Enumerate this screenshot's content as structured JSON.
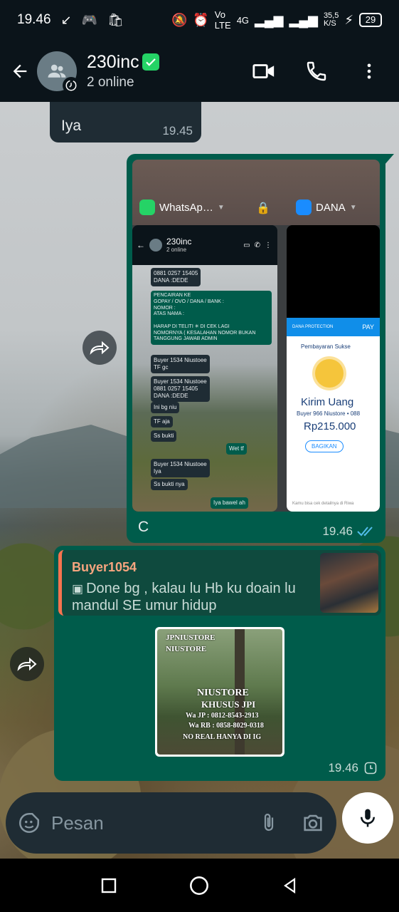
{
  "status_bar": {
    "time": "19.46",
    "net_speed": "35,5\nK/S",
    "battery": "29",
    "network": "4G"
  },
  "header": {
    "title": "230inc",
    "subtitle": "2 online"
  },
  "messages": [
    {
      "text": "Iya",
      "time": "19.45"
    },
    {
      "caption": "C",
      "time": "19.46",
      "screenshot": {
        "app1": "WhatsAp…",
        "app2": "DANA",
        "mini_title": "230inc",
        "mini_sub": "2 online",
        "lines": [
          "0881 0257 15405\nDANA :DEDE",
          "PENCAIRAN KE\nGOPAY / OVO / DANA / BANK :\nNOMOR :\nATAS NAMA :\n\nHARAP DI TELITI ✳ DI CEK LAGI\nNOMORNYA ( KESALAHAN NOMOR BUKAN\nTANGGUNG JAWAB ADMIN",
          "Buyer 1534 Niustoee\nTF gc",
          "Buyer 1534 Niustoee\n0881 0257 15405\nDANA :DEDE",
          "Ini bg niu",
          "TF aja",
          "Ss bukti",
          "Wet tf",
          "Buyer 1534 Niustoee\nIya",
          "Ss bukti nya",
          "Iya bawel ah"
        ],
        "dana": {
          "protection": "DANA PROTECTION",
          "pay": "PAY",
          "payment_title": "Pembayaran Sukse",
          "kirim": "Kirim Uang",
          "buyer": "Buyer 966 Niustore • 088",
          "amount": "Rp215.000",
          "share": "BAGIKAN",
          "footer": "Kamu bisa cek detailnya di Riwa"
        }
      }
    },
    {
      "quote_author": "Buyer1054",
      "quote_text": "Done bg , kalau lu Hb ku doain lu mandul SE umur hidup",
      "sticker_lines": [
        "JPNIUSTORE",
        "NIUSTORE",
        "NIUSTORE",
        "KHUSUS JPI",
        "Wa JP : 0812-8543-2913",
        "Wa RB : 0858-8029-0318",
        "NO REAL HANYA DI IG"
      ],
      "time": "19.46"
    }
  ],
  "input": {
    "placeholder": "Pesan"
  },
  "colors": {
    "bubble_out": "#005c4b",
    "bubble_in": "#1f2c34",
    "accent": "#25d366",
    "header_bg": "#0b141a",
    "tick_read": "#53bdeb"
  }
}
